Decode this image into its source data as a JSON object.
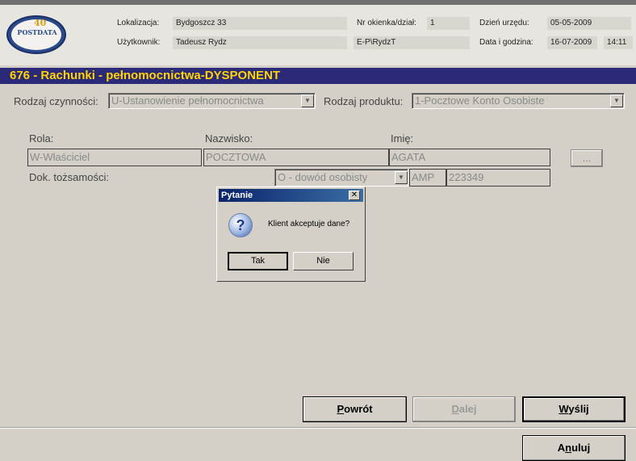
{
  "header": {
    "logo_text": "POSTDATA",
    "logo_num": "40",
    "location_label": "Lokalizacja:",
    "location_value": "Bydgoszcz 33",
    "window_label": "Nr okienka/dział:",
    "window_value": "1",
    "office_day_label": "Dzień urzędu:",
    "office_day_value": "05-05-2009",
    "user_label": "Użytkownik:",
    "user_value": "Tadeusz Rydz",
    "user_id": "E-P\\RydzT",
    "datetime_label": "Data i godzina:",
    "date_value": "16-07-2009",
    "time_value": "14:11"
  },
  "banner": {
    "title": "676 - Rachunki - pełnomocnictwa-DYSPONENT"
  },
  "form": {
    "activity_label": "Rodzaj czynności:",
    "activity_value": "U-Ustanowienie pełnomocnictwa",
    "product_label": "Rodzaj produktu:",
    "product_value": "1-Pocztowe Konto Osobiste",
    "role_label": "Rola:",
    "role_value": "W-Właściciel",
    "surname_label": "Nazwisko:",
    "surname_value": "POCZTOWA",
    "firstname_label": "Imię:",
    "firstname_value": "AGATA",
    "ellipsis_label": "...",
    "id_doc_label": "Dok. tożsamości:",
    "id_doc_type": "O - dowód osobisty",
    "id_series": "AMP",
    "id_number": "223349"
  },
  "buttons": {
    "back_prefix": "",
    "back_underline": "P",
    "back_rest": "owrót",
    "next_underline": "D",
    "next_rest": "alej",
    "send_underline": "W",
    "send_rest": "yślij",
    "cancel_prefix": "A",
    "cancel_underline": "n",
    "cancel_rest": "uluj"
  },
  "dialog": {
    "title": "Pytanie",
    "message": "Klient akceptuje dane?",
    "yes_label": "Tak",
    "no_label": "Nie"
  }
}
